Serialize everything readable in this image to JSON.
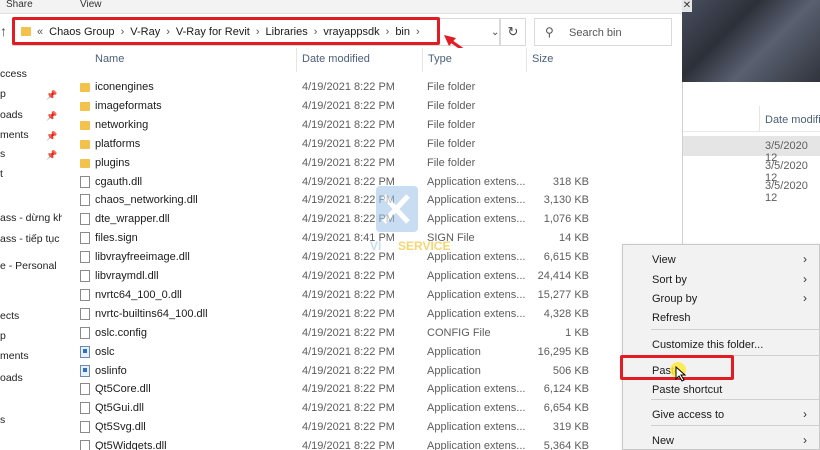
{
  "ribbon": {
    "tabs": [
      "Share",
      "View"
    ]
  },
  "address": {
    "overflow": "«",
    "crumbs": [
      "Chaos Group",
      "V-Ray",
      "V-Ray for Revit",
      "Libraries",
      "vrayappsdk",
      "bin"
    ]
  },
  "search": {
    "placeholder": "Search bin"
  },
  "nav_pane": {
    "items": [
      {
        "label": "ccess",
        "pinned": false
      },
      {
        "label": "p",
        "pinned": true
      },
      {
        "label": "oads",
        "pinned": true
      },
      {
        "label": "ments",
        "pinned": true
      },
      {
        "label": "s",
        "pinned": true
      },
      {
        "label": "t",
        "pinned": false
      },
      {
        "label": "ass - dừng kh",
        "pinned": false
      },
      {
        "label": "ass - tiếp tục",
        "pinned": false
      },
      {
        "label": "e - Personal",
        "pinned": false
      },
      {
        "label": "ects",
        "pinned": false
      },
      {
        "label": "p",
        "pinned": false
      },
      {
        "label": "ments",
        "pinned": false
      },
      {
        "label": "oads",
        "pinned": false
      },
      {
        "label": "s",
        "pinned": false
      }
    ]
  },
  "columns": {
    "name": "Name",
    "date": "Date modified",
    "type": "Type",
    "size": "Size"
  },
  "files": [
    {
      "name": "iconengines",
      "date": "4/19/2021 8:22 PM",
      "type": "File folder",
      "size": "",
      "icon": "folder"
    },
    {
      "name": "imageformats",
      "date": "4/19/2021 8:22 PM",
      "type": "File folder",
      "size": "",
      "icon": "folder"
    },
    {
      "name": "networking",
      "date": "4/19/2021 8:22 PM",
      "type": "File folder",
      "size": "",
      "icon": "folder"
    },
    {
      "name": "platforms",
      "date": "4/19/2021 8:22 PM",
      "type": "File folder",
      "size": "",
      "icon": "folder"
    },
    {
      "name": "plugins",
      "date": "4/19/2021 8:22 PM",
      "type": "File folder",
      "size": "",
      "icon": "folder"
    },
    {
      "name": "cgauth.dll",
      "date": "4/19/2021 8:22 PM",
      "type": "Application extens...",
      "size": "318 KB",
      "icon": "file"
    },
    {
      "name": "chaos_networking.dll",
      "date": "4/19/2021 8:22 PM",
      "type": "Application extens...",
      "size": "3,130 KB",
      "icon": "file"
    },
    {
      "name": "dte_wrapper.dll",
      "date": "4/19/2021 8:22 PM",
      "type": "Application extens...",
      "size": "1,076 KB",
      "icon": "file"
    },
    {
      "name": "files.sign",
      "date": "4/19/2021 8:41 PM",
      "type": "SIGN File",
      "size": "14 KB",
      "icon": "file"
    },
    {
      "name": "libvrayfreeimage.dll",
      "date": "4/19/2021 8:22 PM",
      "type": "Application extens...",
      "size": "6,615 KB",
      "icon": "file"
    },
    {
      "name": "libvraymdl.dll",
      "date": "4/19/2021 8:22 PM",
      "type": "Application extens...",
      "size": "24,414 KB",
      "icon": "file"
    },
    {
      "name": "nvrtc64_100_0.dll",
      "date": "4/19/2021 8:22 PM",
      "type": "Application extens...",
      "size": "15,277 KB",
      "icon": "file"
    },
    {
      "name": "nvrtc-builtins64_100.dll",
      "date": "4/19/2021 8:22 PM",
      "type": "Application extens...",
      "size": "4,328 KB",
      "icon": "file"
    },
    {
      "name": "oslc.config",
      "date": "4/19/2021 8:22 PM",
      "type": "CONFIG File",
      "size": "1 KB",
      "icon": "file"
    },
    {
      "name": "oslc",
      "date": "4/19/2021 8:22 PM",
      "type": "Application",
      "size": "16,295 KB",
      "icon": "app"
    },
    {
      "name": "oslinfo",
      "date": "4/19/2021 8:22 PM",
      "type": "Application",
      "size": "506 KB",
      "icon": "app"
    },
    {
      "name": "Qt5Core.dll",
      "date": "4/19/2021 8:22 PM",
      "type": "Application extens...",
      "size": "6,124 KB",
      "icon": "file"
    },
    {
      "name": "Qt5Gui.dll",
      "date": "4/19/2021 8:22 PM",
      "type": "Application extens...",
      "size": "6,654 KB",
      "icon": "file"
    },
    {
      "name": "Qt5Svg.dll",
      "date": "4/19/2021 8:22 PM",
      "type": "Application extens...",
      "size": "319 KB",
      "icon": "file"
    },
    {
      "name": "Qt5Widgets.dll",
      "date": "4/19/2021 8:22 PM",
      "type": "Application extens...",
      "size": "5,364 KB",
      "icon": "file"
    }
  ],
  "background_window": {
    "column_header": "Date modifi",
    "rows": [
      "3/5/2020 12",
      "3/5/2020 12",
      "3/5/2020 12"
    ]
  },
  "watermark": {
    "text": "SERVICE",
    "prefix": "VI"
  },
  "context_menu": {
    "items": [
      {
        "label": "View",
        "submenu": true
      },
      {
        "label": "Sort by",
        "submenu": true
      },
      {
        "label": "Group by",
        "submenu": true
      },
      {
        "label": "Refresh",
        "submenu": false
      },
      {
        "label": "Customize this folder...",
        "submenu": false
      },
      {
        "label": "Paste",
        "submenu": false
      },
      {
        "label": "Paste shortcut",
        "submenu": false
      },
      {
        "label": "Give access to",
        "submenu": true
      },
      {
        "label": "New",
        "submenu": true
      }
    ]
  },
  "colors": {
    "highlight": "#e31b23",
    "folder": "#f3c24c",
    "header_text": "#4c607a"
  }
}
